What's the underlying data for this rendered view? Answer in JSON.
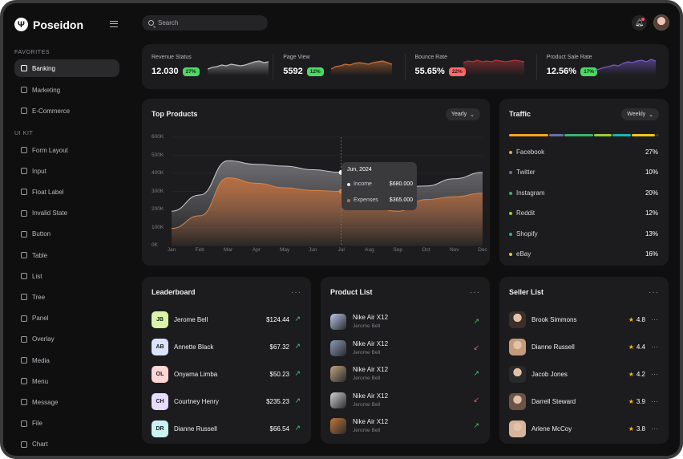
{
  "app": {
    "name": "Poseidon"
  },
  "sidebar": {
    "favorites_label": "FAVORITES",
    "favorites": [
      {
        "label": "Banking",
        "active": true
      },
      {
        "label": "Marketing"
      },
      {
        "label": "E-Commerce"
      }
    ],
    "uikit_label": "UI KIT",
    "uikit": [
      {
        "label": "Form Layout"
      },
      {
        "label": "Input"
      },
      {
        "label": "Float Label"
      },
      {
        "label": "Invalid State"
      },
      {
        "label": "Button"
      },
      {
        "label": "Table"
      },
      {
        "label": "List"
      },
      {
        "label": "Tree"
      },
      {
        "label": "Panel"
      },
      {
        "label": "Overlay"
      },
      {
        "label": "Media"
      },
      {
        "label": "Menu"
      },
      {
        "label": "Message"
      },
      {
        "label": "File"
      },
      {
        "label": "Chart"
      }
    ]
  },
  "topbar": {
    "search_placeholder": "Search"
  },
  "stats": [
    {
      "label": "Revenue Status",
      "value": "12.030",
      "badge": "27%",
      "trend": "up",
      "color": "#bdbdc2"
    },
    {
      "label": "Page View",
      "value": "5592",
      "badge": "12%",
      "trend": "up",
      "color": "#c8703a"
    },
    {
      "label": "Bounce Rate",
      "value": "55.65%",
      "badge": "22%",
      "trend": "down",
      "color": "#b0353a"
    },
    {
      "label": "Product Sale Rate",
      "value": "12.56%",
      "badge": "17%",
      "trend": "up",
      "color": "#7a59c9"
    }
  ],
  "top_products": {
    "title": "Top Products",
    "period": "Yearly",
    "tooltip": {
      "date": "Jun, 2024",
      "income_label": "Income",
      "income_value": "$680.000",
      "expenses_label": "Expenses",
      "expenses_value": "$365.000"
    }
  },
  "chart_data": {
    "type": "area",
    "title": "Top Products",
    "categories": [
      "Jan",
      "Feb",
      "Mar",
      "Apr",
      "May",
      "Jun",
      "Jul",
      "Aug",
      "Sep",
      "Oct",
      "Nov",
      "Dec"
    ],
    "y_ticks": [
      "0K",
      "100K",
      "200K",
      "300K",
      "400K",
      "500K",
      "600K"
    ],
    "ylim": [
      0,
      600
    ],
    "series": [
      {
        "name": "Income",
        "color": "#8a8a8f",
        "values": [
          190,
          280,
          470,
          450,
          440,
          420,
          405,
          330,
          320,
          330,
          370,
          405
        ]
      },
      {
        "name": "Expenses",
        "color": "#c8703a",
        "values": [
          95,
          165,
          375,
          345,
          320,
          305,
          300,
          215,
          190,
          255,
          270,
          290
        ]
      }
    ],
    "highlight_index": 6,
    "grid": true,
    "legend": "none"
  },
  "traffic": {
    "title": "Traffic",
    "period": "Weekly",
    "items": [
      {
        "label": "Facebook",
        "pct": "27%",
        "color": "#f5a623"
      },
      {
        "label": "Twitter",
        "pct": "10%",
        "color": "#6b6f9e"
      },
      {
        "label": "Instagram",
        "pct": "20%",
        "color": "#3cb371"
      },
      {
        "label": "Reddit",
        "pct": "12%",
        "color": "#9acd32"
      },
      {
        "label": "Shopify",
        "pct": "13%",
        "color": "#20b2aa"
      },
      {
        "label": "eBay",
        "pct": "16%",
        "color": "#f5c518"
      }
    ]
  },
  "leaderboard": {
    "title": "Leaderboard",
    "rows": [
      {
        "initials": "JB",
        "name": "Jerome Bell",
        "amount": "$124.44",
        "color": "#d9f5a8"
      },
      {
        "initials": "AB",
        "name": "Annette Black",
        "amount": "$67.32",
        "color": "#dbe4ff"
      },
      {
        "initials": "OL",
        "name": "Onyama Limba",
        "amount": "$50.23",
        "color": "#ffd6d6"
      },
      {
        "initials": "CH",
        "name": "Courtney Henry",
        "amount": "$235.23",
        "color": "#e6dcff"
      },
      {
        "initials": "DR",
        "name": "Dianne Russell",
        "amount": "$66.54",
        "color": "#c9f2f5"
      }
    ]
  },
  "product_list": {
    "title": "Product List",
    "rows": [
      {
        "name": "Nike Air X12",
        "seller": "Jerome Bell",
        "trend": "up"
      },
      {
        "name": "Nike Air X12",
        "seller": "Jerome Bell",
        "trend": "down"
      },
      {
        "name": "Nike Air X12",
        "seller": "Jerome Bell",
        "trend": "up"
      },
      {
        "name": "Nike Air X12",
        "seller": "Jerome Bell",
        "trend": "down"
      },
      {
        "name": "Nike Air X12",
        "seller": "Jerome Bell",
        "trend": "up"
      }
    ]
  },
  "seller_list": {
    "title": "Seller List",
    "rows": [
      {
        "name": "Brook Simmons",
        "rating": "4.8"
      },
      {
        "name": "Dianne Russell",
        "rating": "4.4"
      },
      {
        "name": "Jacob Jones",
        "rating": "4.2"
      },
      {
        "name": "Darrell Steward",
        "rating": "3.9"
      },
      {
        "name": "Arlene McCoy",
        "rating": "3.8"
      }
    ]
  }
}
